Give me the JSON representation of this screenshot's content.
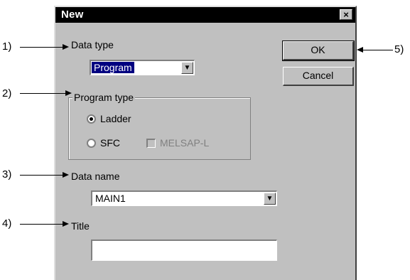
{
  "dialog": {
    "title": "New",
    "close_label": "×",
    "data_type": {
      "label": "Data type",
      "selected": "Program"
    },
    "program_type": {
      "label": "Program type",
      "options": [
        {
          "label": "Ladder",
          "selected": true
        },
        {
          "label": "SFC",
          "selected": false
        }
      ],
      "checkbox": {
        "label": "MELSAP-L",
        "checked": false,
        "enabled": false
      }
    },
    "data_name": {
      "label": "Data name",
      "value": "MAIN1"
    },
    "title_field": {
      "label": "Title",
      "value": ""
    },
    "buttons": {
      "ok": "OK",
      "cancel": "Cancel"
    }
  },
  "callouts": [
    "1)",
    "2)",
    "3)",
    "4)",
    "5)"
  ]
}
